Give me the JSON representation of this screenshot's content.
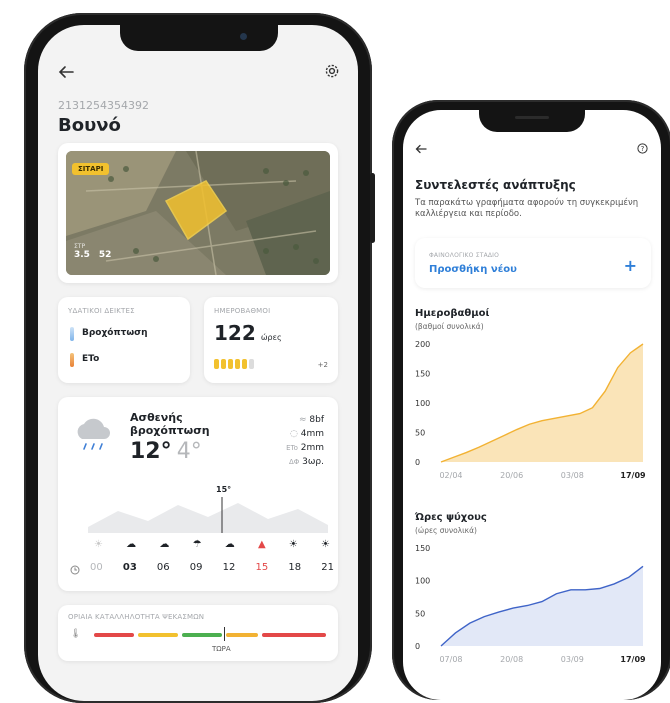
{
  "left": {
    "field_id": "2131254354392",
    "field_name": "Βουνό",
    "map": {
      "crop_badge": "ΣΙΤΑΡΙ",
      "stat1_label": "ΣΤΡ",
      "stat1_value": "3.5",
      "stat2_value": "52"
    },
    "water": {
      "title": "ΥΔΑΤΙΚΟΙ ΔΕΙΚΤΕΣ",
      "item1": "Βροχόπτωση",
      "item2": "ETo"
    },
    "degree_days": {
      "title": "ΗΜΕΡΟΒΑΘΜΟΙ",
      "value": "122",
      "unit": "ώρες",
      "more": "+2"
    },
    "weather": {
      "condition": "Ασθενής βροχόπτωση",
      "temp_high": "12°",
      "temp_low": "4°",
      "wind": "8bf",
      "rain": "4mm",
      "eto_label": "ETo",
      "eto": "2mm",
      "dp_label": "ΔΦ",
      "dp": "3ωρ.",
      "marker_temp": "15°",
      "hours": [
        "00",
        "03",
        "06",
        "09",
        "12",
        "15",
        "18",
        "21"
      ]
    },
    "spray": {
      "title": "ΟΡΙΑΙΑ ΚΑΤΑΛΛΗΛΟΤΗΤΑ ΨΕΚΑΣΜΩΝ",
      "now_label": "ΤΩΡΑ"
    }
  },
  "right": {
    "title": "Συντελεστές ανάπτυξης",
    "subtitle": "Τα παρακάτω γραφήματα αφορούν τη συγκεκριμένη καλλιέργεια και περίοδο.",
    "stage_label": "ΦΑΙΝΟΛΟΓΙΚΟ ΣΤΑΔΙΟ",
    "stage_action": "Προσθήκη νέου"
  },
  "colors": {
    "accent_blue": "#2f7fd8",
    "orange": "#f2b233",
    "red": "#e34848",
    "green": "#4caf50"
  },
  "chart_data": [
    {
      "type": "area",
      "title": "Ημεροβαθμοί",
      "subtitle": "(βαθμοί συνολικά)",
      "x_ticks": [
        "02/04",
        "20/06",
        "03/08",
        "17/09"
      ],
      "y_ticks": [
        0,
        50,
        100,
        150,
        200
      ],
      "ylim": [
        0,
        200
      ],
      "x": [
        0,
        1,
        2,
        3,
        4,
        5,
        6,
        7,
        8,
        9,
        10,
        11,
        12,
        13,
        14,
        15,
        16
      ],
      "values": [
        0,
        8,
        16,
        25,
        35,
        45,
        55,
        64,
        70,
        74,
        78,
        82,
        92,
        120,
        160,
        185,
        200
      ],
      "color": "#f2b233"
    },
    {
      "type": "area",
      "title": "Ώρες ψύχους",
      "subtitle": "(ώρες συνολικά)",
      "x_ticks": [
        "07/08",
        "20/08",
        "03/09",
        "17/09"
      ],
      "y_ticks": [
        0,
        50,
        100,
        150
      ],
      "ylim": [
        0,
        150
      ],
      "x": [
        0,
        1,
        2,
        3,
        4,
        5,
        6,
        7,
        8,
        9,
        10,
        11,
        12,
        13,
        14
      ],
      "values": [
        0,
        20,
        35,
        45,
        52,
        58,
        62,
        68,
        80,
        86,
        86,
        88,
        95,
        105,
        122
      ],
      "color": "#3f64c8"
    }
  ]
}
